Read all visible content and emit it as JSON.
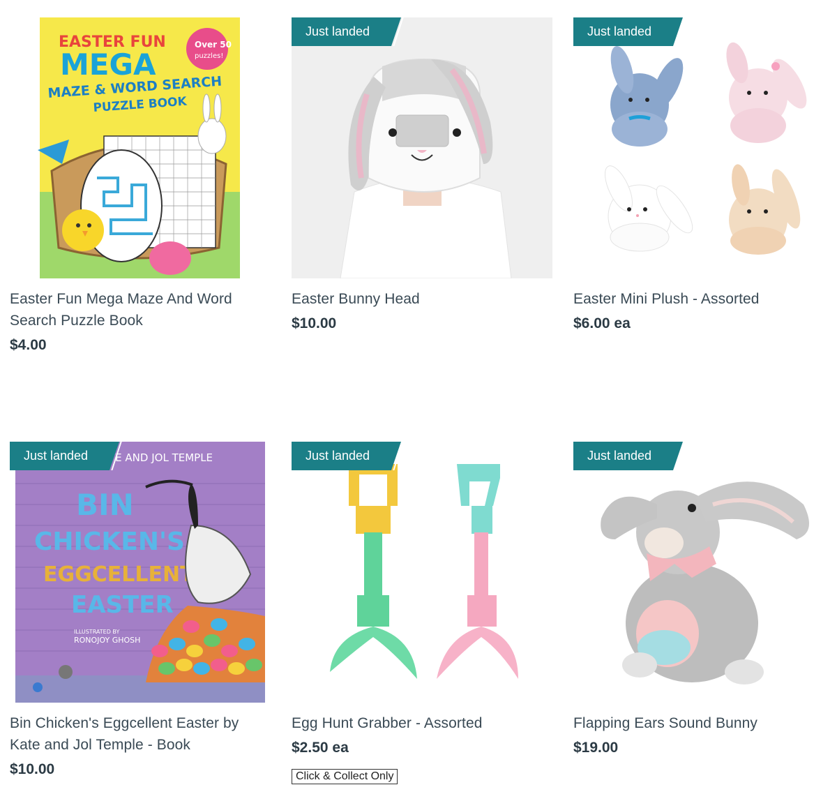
{
  "badge_label": "Just landed",
  "colors": {
    "badge": "#1b7f87",
    "title": "#3a4a55",
    "price": "#2b3a44"
  },
  "products": [
    {
      "title": "Easter Fun Mega Maze And Word Search Puzzle Book",
      "price": "$4.00",
      "badge": "",
      "image": "puzzle-book-cover",
      "cover": {
        "line1": "EASTER FUN",
        "line2": "MEGA",
        "line3": "MAZE & WORD SEARCH",
        "line4": "PUZZLE BOOK",
        "burst_top": "Over 50",
        "burst_bottom": "puzzles!"
      }
    },
    {
      "title": "Easter Bunny Head",
      "price": "$10.00",
      "badge": "Just landed",
      "image": "bunny-head-costume"
    },
    {
      "title": "Easter Mini Plush - Assorted",
      "price": "$6.00 ea",
      "badge": "Just landed",
      "image": "mini-plush-bunnies"
    },
    {
      "title": "Bin Chicken's Eggcellent Easter by Kate and Jol Temple - Book",
      "price": "$10.00",
      "badge": "Just landed",
      "image": "bin-chicken-book-cover",
      "cover": {
        "authors": "TE AND JOL TEMPLE",
        "line1": "BIN",
        "line2": "CHICKEN'S",
        "line3": "EGGCELLENT",
        "line4": "EASTER",
        "illustrator_label": "ILLUSTRATED BY",
        "illustrator": "RONOJOY GHOSH"
      }
    },
    {
      "title": "Egg Hunt Grabber - Assorted",
      "price": "$2.50 ea",
      "badge": "Just landed",
      "image": "egg-hunt-grabbers",
      "extra_button": "Click & Collect Only"
    },
    {
      "title": "Flapping Ears Sound Bunny",
      "price": "$19.00",
      "badge": "Just landed",
      "image": "grey-plush-bunny"
    }
  ]
}
